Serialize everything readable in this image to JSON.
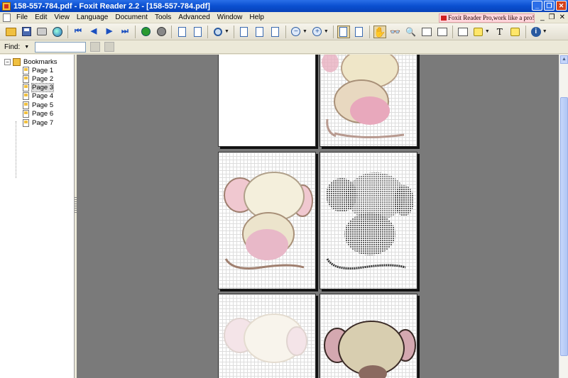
{
  "window": {
    "title": "158-557-784.pdf - Foxit Reader 2.2 - [158-557-784.pdf]",
    "minimize": "_",
    "maximize": "❐",
    "close": "✕"
  },
  "menubar": {
    "items": [
      "File",
      "Edit",
      "View",
      "Language",
      "Document",
      "Tools",
      "Advanced",
      "Window",
      "Help"
    ],
    "promo": "Foxit Reader Pro,work like a pro!",
    "mdi_minimize": "_",
    "mdi_restore": "❐",
    "mdi_close": "✕"
  },
  "toolbar": {
    "icons": [
      "open-folder",
      "save-disk",
      "printer",
      "globe",
      "first-page",
      "previous-page",
      "next-page",
      "last-page",
      "go-back",
      "go-forward",
      "rotate-left",
      "rotate-right",
      "zoom",
      "actual-size",
      "fit-page",
      "fit-width",
      "zoom-out",
      "zoom-in",
      "bookmarks-panel",
      "thumbnails-panel",
      "hand-tool",
      "glasses",
      "find-binoculars",
      "select-text",
      "snapshot",
      "typewriter",
      "highlight",
      "text-tool",
      "note",
      "info"
    ],
    "first": "⏮",
    "prev": "◀",
    "next": "▶",
    "last": "⏭",
    "zoom_out": "−",
    "zoom_in": "+",
    "text_tool": "T",
    "info": "i"
  },
  "findbar": {
    "label": "Find:",
    "dropdown": "▼",
    "value": ""
  },
  "sidebar": {
    "root": "Bookmarks",
    "expander": "−",
    "pages": [
      "Page 1",
      "Page 2",
      "Page 3",
      "Page 4",
      "Page 5",
      "Page 6",
      "Page 7"
    ],
    "selected_index": 2
  },
  "scrollbar": {
    "up": "▲",
    "down": "▼"
  },
  "colors": {
    "title_bar": "#0a4fd0",
    "viewport_bg": "#7a7a7a",
    "promo_bg": "#ffd6dc"
  }
}
